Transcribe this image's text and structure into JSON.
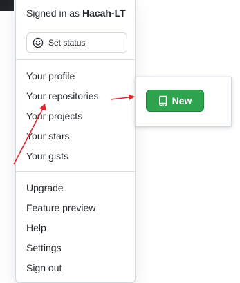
{
  "header": {
    "signed_in_prefix": "Signed in as",
    "username": "Hacah-LT"
  },
  "status": {
    "label": "Set status",
    "icon": "smiley-icon"
  },
  "menu_primary": {
    "profile": "Your profile",
    "repositories": "Your repositories",
    "projects": "Your projects",
    "stars": "Your stars",
    "gists": "Your gists"
  },
  "menu_secondary": {
    "upgrade": "Upgrade",
    "feature_preview": "Feature preview",
    "help": "Help",
    "settings": "Settings",
    "sign_out": "Sign out"
  },
  "new_repo": {
    "label": "New",
    "icon": "repo-icon"
  },
  "colors": {
    "new_button": "#2ea44f",
    "arrow": "#e0262b",
    "dark_strip": "#1f2328"
  }
}
